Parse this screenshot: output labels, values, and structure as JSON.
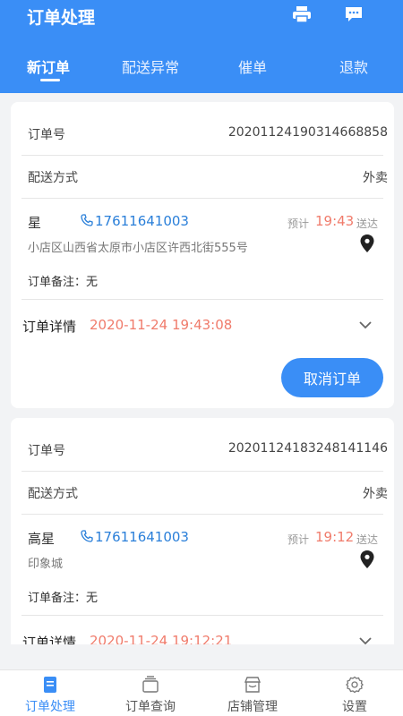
{
  "header": {
    "title": "订单处理",
    "background_color": "#3a8ef6",
    "icons": [
      "printer-icon",
      "message-icon"
    ]
  },
  "tabs": [
    {
      "label": "新订单",
      "active": true
    },
    {
      "label": "配送异常",
      "active": false
    },
    {
      "label": "催单",
      "active": false
    },
    {
      "label": "退款",
      "active": false
    }
  ],
  "orders": [
    {
      "order_no_label": "订单号",
      "order_no": "20201124190314668858",
      "delivery_label": "配送方式",
      "delivery_method": "外卖",
      "customer": "星",
      "phone": "17611641003",
      "est_label": "预计",
      "est_time": "19:43",
      "send_label": "送达",
      "address": "小店区山西省太原市小店区许西北街555号",
      "note": "订单备注：无",
      "detail_label": "订单详情",
      "detail_time": "2020-11-24 19:43:08",
      "cancel_label": "取消订单"
    },
    {
      "order_no_label": "订单号",
      "order_no": "20201124183248141146",
      "delivery_label": "配送方式",
      "delivery_method": "外卖",
      "customer": "高星",
      "phone": "17611641003",
      "est_label": "预计",
      "est_time": "19:12",
      "send_label": "送达",
      "address": "印象城",
      "note": "订单备注：无",
      "detail_label": "订单详情",
      "detail_time": "2020-11-24 19:12:21"
    }
  ],
  "bottom_nav": [
    {
      "label": "订单处理",
      "icon": "order-list-icon",
      "active": true
    },
    {
      "label": "订单查询",
      "icon": "order-query-icon",
      "active": false
    },
    {
      "label": "店铺管理",
      "icon": "store-icon",
      "active": false
    },
    {
      "label": "设置",
      "icon": "settings-icon",
      "active": false
    }
  ],
  "colors": {
    "accent": "#3a8ef6",
    "time_highlight": "#f07b6b",
    "phone_link": "#2a7fd9"
  }
}
